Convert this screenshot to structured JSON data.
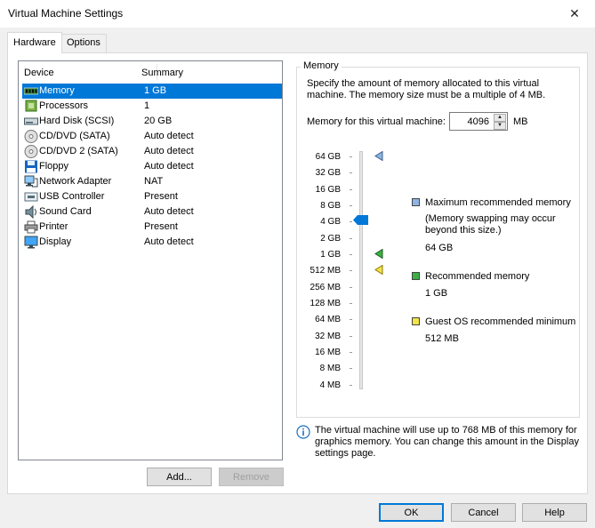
{
  "window": {
    "title": "Virtual Machine Settings",
    "close_glyph": "✕"
  },
  "tabs": [
    {
      "label": "Hardware",
      "active": true
    },
    {
      "label": "Options",
      "active": false
    }
  ],
  "device_list": {
    "columns": {
      "device": "Device",
      "summary": "Summary"
    },
    "items": [
      {
        "name": "Memory",
        "summary": "1 GB",
        "icon": "memory-icon",
        "selected": true
      },
      {
        "name": "Processors",
        "summary": "1",
        "icon": "processor-icon"
      },
      {
        "name": "Hard Disk (SCSI)",
        "summary": "20 GB",
        "icon": "hard-disk-icon"
      },
      {
        "name": "CD/DVD (SATA)",
        "summary": "Auto detect",
        "icon": "cd-dvd-icon"
      },
      {
        "name": "CD/DVD 2 (SATA)",
        "summary": "Auto detect",
        "icon": "cd-dvd-icon"
      },
      {
        "name": "Floppy",
        "summary": "Auto detect",
        "icon": "floppy-icon"
      },
      {
        "name": "Network Adapter",
        "summary": "NAT",
        "icon": "network-adapter-icon"
      },
      {
        "name": "USB Controller",
        "summary": "Present",
        "icon": "usb-controller-icon"
      },
      {
        "name": "Sound Card",
        "summary": "Auto detect",
        "icon": "sound-card-icon"
      },
      {
        "name": "Printer",
        "summary": "Present",
        "icon": "printer-icon"
      },
      {
        "name": "Display",
        "summary": "Auto detect",
        "icon": "display-icon"
      }
    ],
    "add_label": "Add...",
    "remove_label": "Remove"
  },
  "memory": {
    "group_title": "Memory",
    "description": "Specify the amount of memory allocated to this virtual machine. The memory size must be a multiple of 4 MB.",
    "field_label": "Memory for this virtual machine:",
    "value": "4096",
    "unit": "MB",
    "scale_labels": [
      "64 GB",
      "32 GB",
      "16 GB",
      "8 GB",
      "4 GB",
      "2 GB",
      "1 GB",
      "512 MB",
      "256 MB",
      "128 MB",
      "64 MB",
      "32 MB",
      "16 MB",
      "8 MB",
      "4 MB"
    ],
    "slider_level": "4 GB",
    "legend": [
      {
        "label": "Maximum recommended memory",
        "note": "(Memory swapping may occur beyond this size.)",
        "value": "64 GB",
        "color": "#8eb4e3"
      },
      {
        "label": "Recommended memory",
        "value": "1 GB",
        "color": "#3cb043"
      },
      {
        "label": "Guest OS recommended minimum",
        "value": "512 MB",
        "color": "#f2e34b"
      }
    ],
    "info_text": "The virtual machine will use up to 768 MB of this memory for graphics memory. You can change this amount in the Display settings page."
  },
  "buttons": {
    "ok": "OK",
    "cancel": "Cancel",
    "help": "Help"
  },
  "colors": {
    "selection": "#0078d7",
    "default_border": "#0078d7"
  }
}
